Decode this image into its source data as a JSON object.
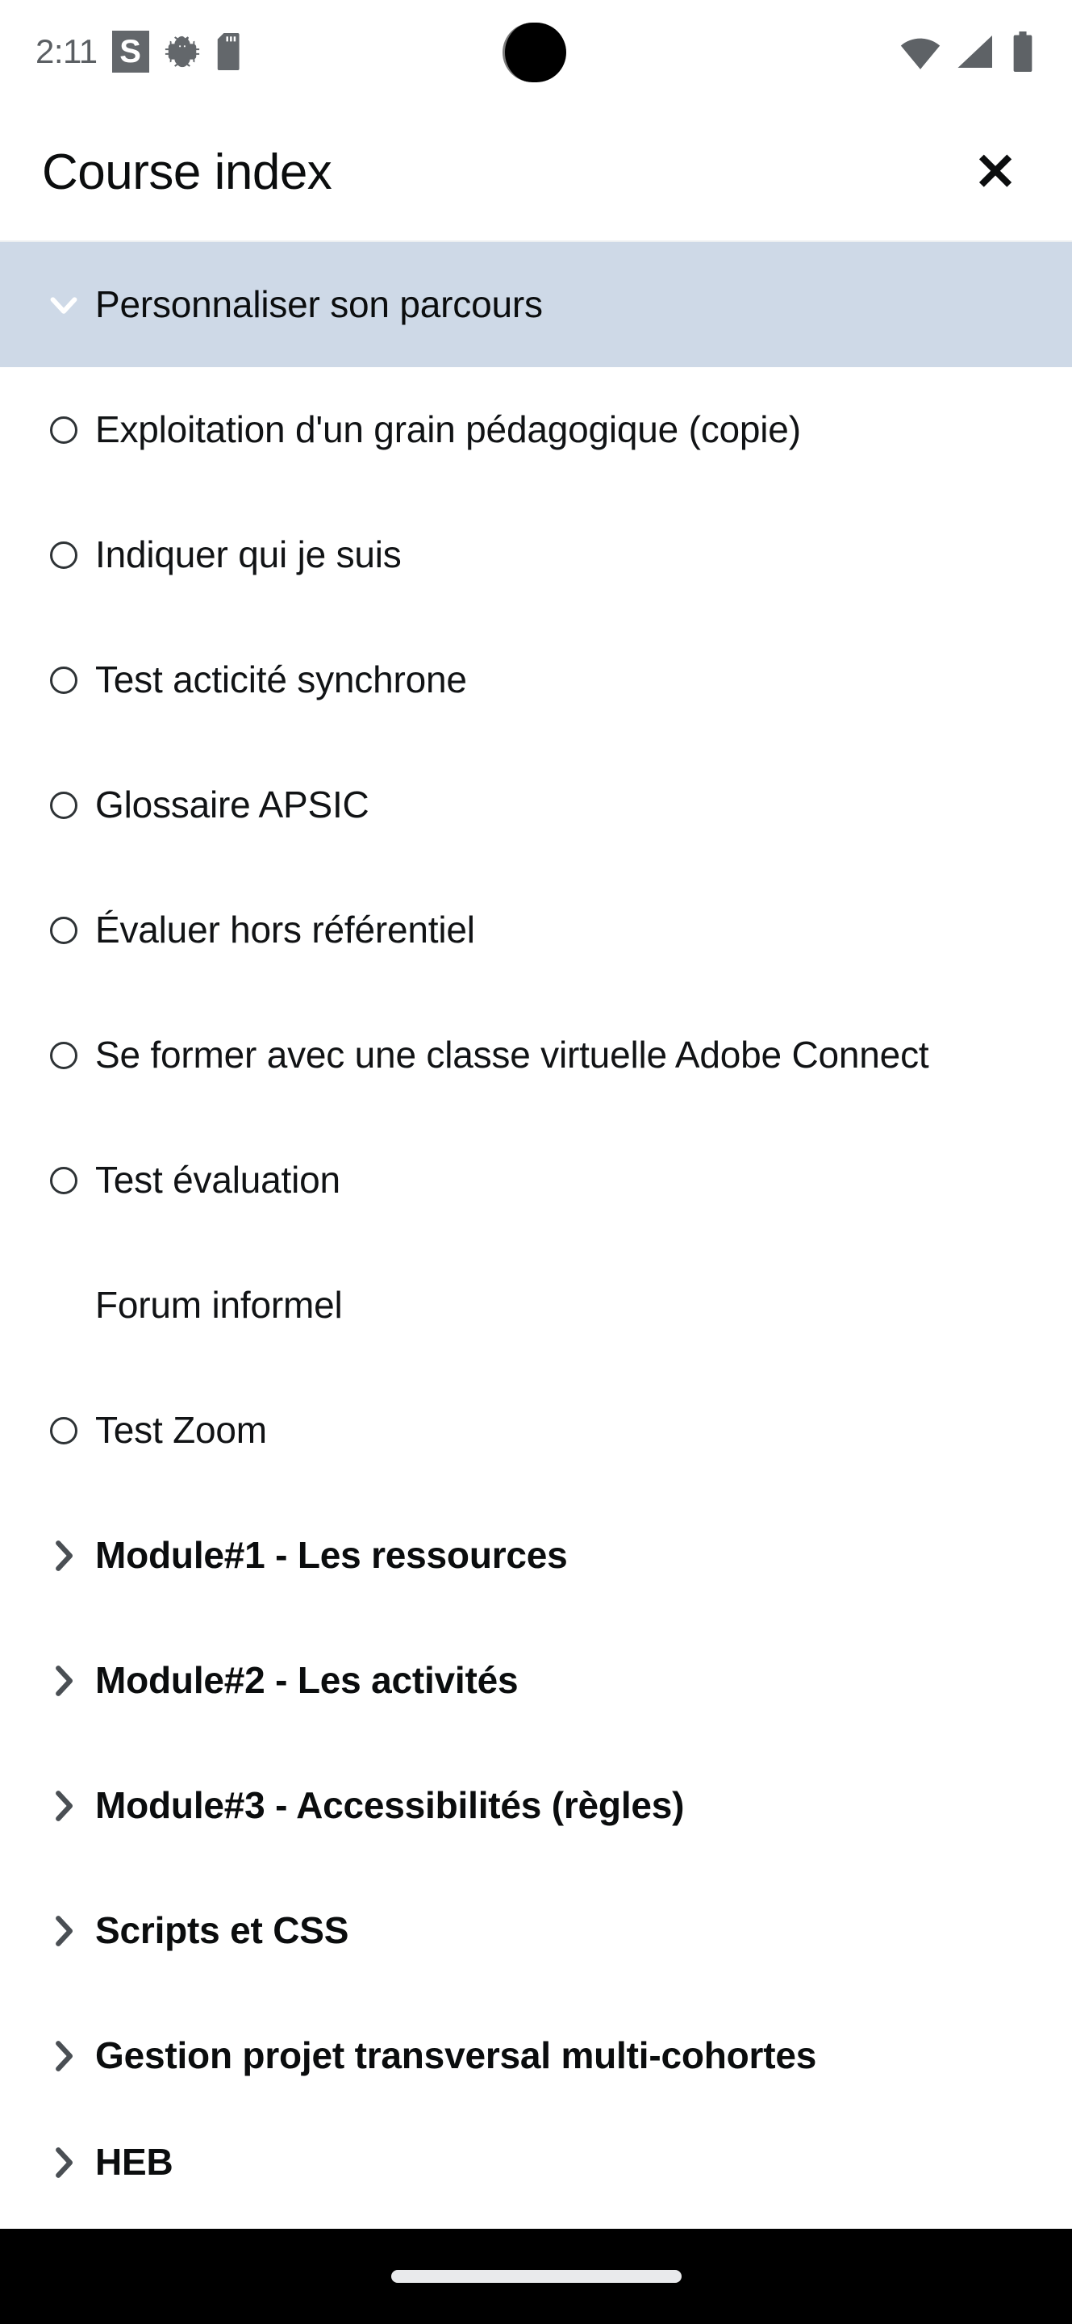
{
  "status_bar": {
    "time": "2:11",
    "badge_letter": "S",
    "icons": [
      "s-badge-icon",
      "android-bug-icon",
      "sd-card-icon",
      "camera-notch",
      "wifi-icon",
      "cell-signal-icon",
      "battery-icon"
    ]
  },
  "header": {
    "title": "Course index",
    "close_label": "✕"
  },
  "colors": {
    "section_highlight": "#ced9e7",
    "text": "#111315",
    "chevron": "#4a4f54",
    "chevron_open": "#ffffff",
    "navbar": "#000000"
  },
  "course_index": {
    "rows": [
      {
        "label": "Personnaliser son parcours",
        "icon": "chevron-down-icon",
        "type": "section",
        "expanded": true,
        "highlighted": true
      },
      {
        "label": "Exploitation d'un grain pédagogique (copie)",
        "icon": "completion-circle-icon",
        "type": "activity",
        "highlighted": false
      },
      {
        "label": "Indiquer qui je suis",
        "icon": "completion-circle-icon",
        "type": "activity",
        "highlighted": false
      },
      {
        "label": "Test acticité synchrone",
        "icon": "completion-circle-icon",
        "type": "activity",
        "highlighted": false
      },
      {
        "label": "Glossaire APSIC",
        "icon": "completion-circle-icon",
        "type": "activity",
        "highlighted": false
      },
      {
        "label": "Évaluer hors référentiel",
        "icon": "completion-circle-icon",
        "type": "activity",
        "highlighted": false
      },
      {
        "label": "Se former avec une classe virtuelle Adobe Connect",
        "icon": "completion-circle-icon",
        "type": "activity",
        "highlighted": false
      },
      {
        "label": "Test évaluation",
        "icon": "completion-circle-icon",
        "type": "activity",
        "highlighted": false
      },
      {
        "label": "Forum informel",
        "icon": "none",
        "type": "activity",
        "highlighted": false
      },
      {
        "label": "Test Zoom",
        "icon": "completion-circle-icon",
        "type": "activity",
        "highlighted": false
      },
      {
        "label": "Module#1 - Les ressources",
        "icon": "chevron-right-icon",
        "type": "section",
        "expanded": false,
        "highlighted": false
      },
      {
        "label": "Module#2 - Les activités",
        "icon": "chevron-right-icon",
        "type": "section",
        "expanded": false,
        "highlighted": false
      },
      {
        "label": "Module#3 - Accessibilités (règles)",
        "icon": "chevron-right-icon",
        "type": "section",
        "expanded": false,
        "highlighted": false
      },
      {
        "label": "Scripts et CSS",
        "icon": "chevron-right-icon",
        "type": "section",
        "expanded": false,
        "highlighted": false
      },
      {
        "label": "Gestion projet transversal multi-cohortes",
        "icon": "chevron-right-icon",
        "type": "section",
        "expanded": false,
        "highlighted": false
      },
      {
        "label": "HEB",
        "icon": "chevron-right-icon",
        "type": "section",
        "expanded": false,
        "highlighted": false,
        "clipped": true
      }
    ]
  },
  "nav_bar": {
    "gesture_pill": "home-gesture-pill"
  }
}
